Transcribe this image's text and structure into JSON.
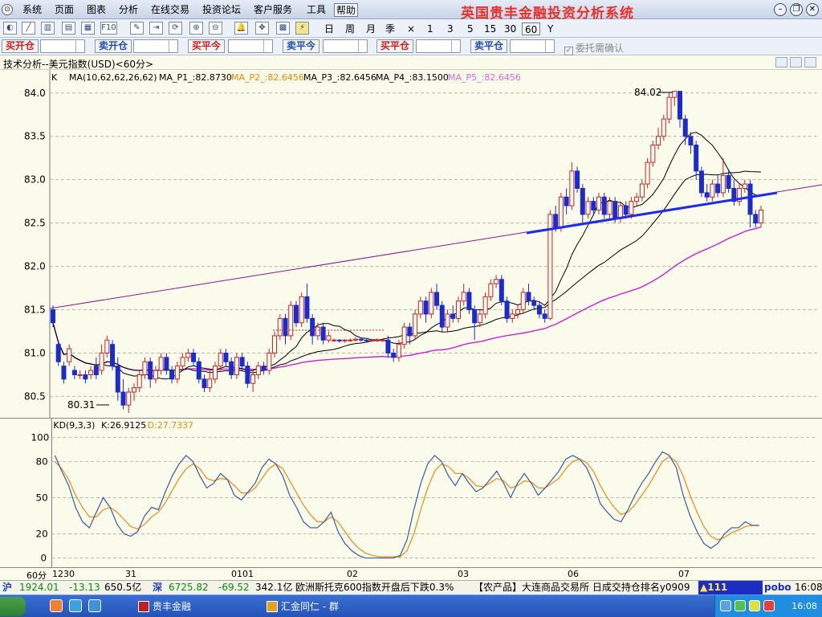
{
  "menubar": {
    "items": [
      "系统",
      "页面",
      "图表",
      "分析",
      "在线交易",
      "投资论坛",
      "客户服务",
      "工具",
      "帮助"
    ],
    "brand": "英国贵丰金融投资分析系统"
  },
  "toolbar": {
    "periods": [
      "日",
      "周",
      "月",
      "季",
      "×",
      "1",
      "3",
      "5",
      "15",
      "30",
      "60",
      "Y"
    ],
    "active_period": "60"
  },
  "trade_bar": {
    "buttons": [
      {
        "label": "买开仓",
        "side": "buy"
      },
      {
        "label": "卖开仓",
        "side": "sell"
      },
      {
        "label": "买平今",
        "side": "buy"
      },
      {
        "label": "卖平今",
        "side": "sell"
      },
      {
        "label": "买平仓",
        "side": "buy"
      },
      {
        "label": "卖平仓",
        "side": "sell"
      }
    ],
    "confirm_label": "委托需确认",
    "confirm_checked": true
  },
  "chart_title": "技术分析--美元指数(USD)<60分>",
  "legend": {
    "k": "K",
    "ma": "MA(10,62,62,26,62)",
    "ma1": "MA_P1_:82.8730",
    "ma2": "MA_P2_:82.6456",
    "ma3": "MA_P3_:82.6456",
    "ma4": "MA_P4_:83.1500",
    "ma5": "MA_P5_:82.6456"
  },
  "kd_legend": {
    "name": "KD(9,3,3)",
    "k": "K:26.9125",
    "d": "D:27.7337"
  },
  "period_label": "60分",
  "ticker": {
    "sh_label": "沪",
    "sh_value": "1924.01",
    "sh_change": "-13.13",
    "sh_volume": "650.5亿",
    "sz_label": "深",
    "sz_value": "6725.82",
    "sz_change": "-69.52",
    "sz_volume": "342.1亿",
    "news1": "欧洲斯托克600指数开盘后下跌0.3%",
    "news2": "【农产品】大连商品交易所 日成交持仓排名y0909",
    "alert": "111",
    "brand": "pobo",
    "time": "16:08"
  },
  "taskbar": {
    "apps": [
      "贵丰金融",
      "汇金同仁 - 群"
    ],
    "clock": "16:08"
  },
  "colors": {
    "bg": "#fbfbec",
    "up": "#cc2222",
    "down": "#1b2bd0",
    "ma1": "#000000",
    "ma2": "#ff8800",
    "ma3": "#cc22cc",
    "grid": "#b8b8a8",
    "trend": "#8a1a8a",
    "support": "#1c2ee8",
    "kline": "#3a5a9a",
    "dline": "#ee8a10"
  },
  "chart_data": {
    "type": "candlestick",
    "ylim": [
      80.3,
      84.1
    ],
    "yticks": [
      80.5,
      81.0,
      81.5,
      82.0,
      82.5,
      83.0,
      83.5,
      84.0
    ],
    "x_labels": [
      "1230",
      "31",
      "0101",
      "02",
      "03",
      "06",
      "07"
    ],
    "high_marker": "84.02",
    "low_marker": "80.31",
    "candles": [
      [
        81.5,
        81.35,
        81.55,
        81.3
      ],
      [
        81.1,
        80.9,
        81.15,
        80.85
      ],
      [
        80.85,
        80.7,
        80.9,
        80.65
      ],
      [
        80.9,
        81.05,
        81.1,
        80.85
      ],
      [
        80.8,
        80.75,
        80.85,
        80.7
      ],
      [
        80.75,
        80.75,
        80.8,
        80.7
      ],
      [
        80.75,
        80.7,
        80.8,
        80.65
      ],
      [
        80.75,
        80.8,
        80.85,
        80.7
      ],
      [
        80.85,
        80.75,
        80.95,
        80.7
      ],
      [
        80.8,
        81.0,
        81.1,
        80.75
      ],
      [
        81.0,
        81.15,
        81.2,
        80.95
      ],
      [
        81.1,
        80.85,
        81.15,
        80.8
      ],
      [
        80.85,
        80.55,
        80.95,
        80.45
      ],
      [
        80.55,
        80.4,
        80.7,
        80.35
      ],
      [
        80.4,
        80.55,
        80.6,
        80.31
      ],
      [
        80.55,
        80.6,
        80.65,
        80.45
      ],
      [
        80.6,
        80.75,
        80.8,
        80.55
      ],
      [
        80.75,
        80.9,
        80.95,
        80.7
      ],
      [
        80.9,
        80.7,
        80.95,
        80.6
      ],
      [
        80.7,
        80.8,
        80.85,
        80.65
      ],
      [
        80.8,
        80.95,
        81.0,
        80.75
      ],
      [
        80.95,
        80.8,
        81.0,
        80.75
      ],
      [
        80.8,
        80.7,
        80.85,
        80.65
      ],
      [
        80.7,
        80.85,
        80.9,
        80.65
      ],
      [
        80.85,
        80.95,
        81.0,
        80.8
      ],
      [
        80.95,
        81.0,
        81.05,
        80.9
      ],
      [
        81.0,
        80.9,
        81.05,
        80.85
      ],
      [
        80.9,
        80.7,
        80.95,
        80.65
      ],
      [
        80.7,
        80.6,
        80.75,
        80.55
      ],
      [
        80.6,
        80.7,
        80.8,
        80.55
      ],
      [
        80.7,
        80.85,
        80.9,
        80.65
      ],
      [
        80.85,
        81.0,
        81.05,
        80.8
      ],
      [
        81.0,
        80.9,
        81.05,
        80.85
      ],
      [
        80.9,
        80.75,
        80.95,
        80.7
      ],
      [
        80.75,
        80.95,
        81.0,
        80.7
      ],
      [
        80.95,
        80.85,
        81.0,
        80.8
      ],
      [
        80.85,
        80.65,
        80.9,
        80.6
      ],
      [
        80.65,
        80.75,
        80.8,
        80.55
      ],
      [
        80.75,
        80.85,
        80.9,
        80.7
      ],
      [
        80.85,
        80.8,
        80.9,
        80.75
      ],
      [
        80.8,
        81.0,
        81.05,
        80.75
      ],
      [
        81.0,
        81.2,
        81.25,
        80.95
      ],
      [
        81.2,
        81.4,
        81.45,
        81.15
      ],
      [
        81.4,
        81.2,
        81.45,
        81.1
      ],
      [
        81.2,
        81.55,
        81.6,
        81.15
      ],
      [
        81.55,
        81.35,
        81.6,
        81.3
      ],
      [
        81.35,
        81.65,
        81.7,
        81.3
      ],
      [
        81.65,
        81.4,
        81.8,
        81.35
      ],
      [
        81.4,
        81.2,
        81.45,
        81.1
      ],
      [
        81.2,
        81.3,
        81.35,
        81.15
      ],
      [
        81.3,
        81.15,
        81.35,
        81.1
      ],
      [
        81.15,
        81.2,
        81.25,
        81.12
      ],
      [
        81.15,
        81.15,
        81.17,
        81.13
      ],
      [
        81.15,
        81.14,
        81.16,
        81.12
      ],
      [
        81.14,
        81.15,
        81.16,
        81.12
      ],
      [
        81.15,
        81.15,
        81.17,
        81.13
      ],
      [
        81.15,
        81.16,
        81.18,
        81.13
      ],
      [
        81.16,
        81.15,
        81.18,
        81.13
      ],
      [
        81.15,
        81.14,
        81.16,
        81.12
      ],
      [
        81.14,
        81.15,
        81.16,
        81.13
      ],
      [
        81.15,
        81.15,
        81.17,
        81.13
      ],
      [
        81.15,
        81.15,
        81.17,
        81.13
      ],
      [
        81.15,
        81.0,
        81.2,
        80.95
      ],
      [
        81.0,
        80.95,
        81.05,
        80.9
      ],
      [
        80.95,
        81.1,
        81.15,
        80.9
      ],
      [
        81.1,
        81.3,
        81.35,
        81.05
      ],
      [
        81.3,
        81.2,
        81.35,
        81.1
      ],
      [
        81.2,
        81.45,
        81.5,
        81.15
      ],
      [
        81.45,
        81.6,
        81.65,
        81.4
      ],
      [
        81.6,
        81.45,
        81.65,
        81.35
      ],
      [
        81.45,
        81.7,
        81.75,
        81.4
      ],
      [
        81.7,
        81.55,
        81.8,
        81.5
      ],
      [
        81.55,
        81.3,
        81.6,
        81.25
      ],
      [
        81.3,
        81.45,
        81.5,
        81.25
      ],
      [
        81.45,
        81.4,
        81.55,
        81.35
      ],
      [
        81.4,
        81.6,
        81.65,
        81.35
      ],
      [
        81.6,
        81.7,
        81.8,
        81.55
      ],
      [
        81.7,
        81.5,
        81.75,
        81.45
      ],
      [
        81.5,
        81.35,
        81.55,
        81.15
      ],
      [
        81.35,
        81.45,
        81.5,
        81.3
      ],
      [
        81.45,
        81.65,
        81.7,
        81.4
      ],
      [
        81.65,
        81.8,
        81.85,
        81.6
      ],
      [
        81.8,
        81.85,
        81.9,
        81.75
      ],
      [
        81.85,
        81.6,
        81.9,
        81.55
      ],
      [
        81.6,
        81.4,
        81.65,
        81.35
      ],
      [
        81.4,
        81.45,
        81.5,
        81.35
      ],
      [
        81.45,
        81.5,
        81.55,
        81.4
      ],
      [
        81.5,
        81.7,
        81.75,
        81.45
      ],
      [
        81.7,
        81.6,
        81.8,
        81.55
      ],
      [
        81.6,
        81.55,
        81.65,
        81.5
      ],
      [
        81.55,
        81.45,
        81.6,
        81.4
      ],
      [
        81.45,
        81.4,
        81.5,
        81.35
      ],
      [
        81.4,
        82.6,
        82.65,
        81.38
      ],
      [
        82.6,
        82.45,
        82.7,
        82.4
      ],
      [
        82.45,
        82.8,
        82.85,
        82.4
      ],
      [
        82.8,
        82.7,
        82.9,
        82.6
      ],
      [
        82.7,
        83.1,
        83.2,
        82.65
      ],
      [
        83.1,
        82.9,
        83.15,
        82.85
      ],
      [
        82.9,
        82.6,
        82.95,
        82.5
      ],
      [
        82.6,
        82.75,
        82.8,
        82.55
      ],
      [
        82.75,
        82.65,
        82.8,
        82.6
      ],
      [
        82.65,
        82.8,
        82.85,
        82.6
      ],
      [
        82.8,
        82.6,
        82.85,
        82.55
      ],
      [
        82.6,
        82.75,
        82.8,
        82.55
      ],
      [
        82.75,
        82.55,
        82.8,
        82.5
      ],
      [
        82.55,
        82.7,
        82.75,
        82.5
      ],
      [
        82.7,
        82.6,
        82.75,
        82.55
      ],
      [
        82.6,
        82.75,
        82.8,
        82.55
      ],
      [
        82.75,
        82.8,
        82.85,
        82.7
      ],
      [
        82.8,
        82.95,
        83.0,
        82.75
      ],
      [
        82.95,
        83.2,
        83.25,
        82.9
      ],
      [
        83.2,
        83.4,
        83.45,
        83.15
      ],
      [
        83.4,
        83.5,
        83.6,
        83.35
      ],
      [
        83.5,
        83.7,
        83.75,
        83.45
      ],
      [
        83.7,
        83.95,
        84.0,
        83.65
      ],
      [
        83.95,
        84.02,
        84.02,
        83.85
      ],
      [
        84.02,
        83.7,
        84.02,
        83.6
      ],
      [
        83.7,
        83.5,
        83.75,
        83.4
      ],
      [
        83.5,
        83.4,
        83.55,
        83.3
      ],
      [
        83.4,
        83.1,
        83.45,
        83.0
      ],
      [
        83.1,
        82.85,
        83.15,
        82.8
      ],
      [
        82.85,
        82.8,
        82.95,
        82.75
      ],
      [
        82.8,
        82.95,
        83.0,
        82.75
      ],
      [
        82.95,
        82.85,
        83.05,
        82.8
      ],
      [
        82.85,
        83.05,
        83.25,
        82.8
      ],
      [
        83.05,
        82.9,
        83.1,
        82.85
      ],
      [
        82.9,
        82.75,
        83.0,
        82.7
      ],
      [
        82.75,
        82.9,
        82.95,
        82.7
      ],
      [
        82.9,
        82.95,
        83.0,
        82.85
      ],
      [
        82.95,
        82.6,
        83.0,
        82.45
      ],
      [
        82.6,
        82.5,
        82.65,
        82.45
      ],
      [
        82.5,
        82.65,
        82.7,
        82.45
      ]
    ],
    "kd_ylim": [
      -5,
      105
    ],
    "kd_yticks": [
      0,
      20,
      50,
      80,
      100
    ],
    "kd_k": [
      85,
      72,
      60,
      42,
      30,
      25,
      38,
      50,
      42,
      28,
      20,
      18,
      22,
      35,
      42,
      40,
      55,
      68,
      78,
      85,
      80,
      68,
      58,
      62,
      70,
      65,
      52,
      48,
      55,
      62,
      75,
      82,
      78,
      68,
      52,
      42,
      30,
      25,
      25,
      30,
      38,
      22,
      12,
      6,
      2,
      0,
      0,
      0,
      0,
      0,
      2,
      15,
      40,
      62,
      78,
      85,
      80,
      68,
      60,
      70,
      62,
      55,
      58,
      65,
      72,
      62,
      50,
      62,
      70,
      62,
      52,
      58,
      65,
      72,
      82,
      85,
      82,
      75,
      62,
      45,
      38,
      32,
      30,
      40,
      52,
      62,
      70,
      80,
      88,
      85,
      75,
      52,
      35,
      22,
      12,
      8,
      12,
      20,
      25,
      25,
      30,
      27,
      27
    ],
    "kd_d": [
      80,
      74,
      65,
      52,
      42,
      34,
      34,
      40,
      42,
      38,
      32,
      26,
      24,
      28,
      34,
      38,
      46,
      56,
      66,
      74,
      78,
      74,
      66,
      64,
      66,
      65,
      60,
      54,
      54,
      58,
      66,
      74,
      78,
      74,
      64,
      54,
      44,
      36,
      30,
      30,
      34,
      30,
      22,
      14,
      8,
      4,
      2,
      1,
      1,
      1,
      1,
      6,
      20,
      40,
      58,
      72,
      78,
      76,
      70,
      70,
      66,
      60,
      59,
      62,
      66,
      64,
      58,
      60,
      64,
      63,
      58,
      58,
      62,
      66,
      74,
      80,
      82,
      79,
      72,
      60,
      50,
      42,
      36,
      38,
      44,
      52,
      60,
      70,
      80,
      84,
      80,
      68,
      52,
      38,
      26,
      18,
      15,
      17,
      21,
      23,
      26,
      27,
      27
    ]
  }
}
